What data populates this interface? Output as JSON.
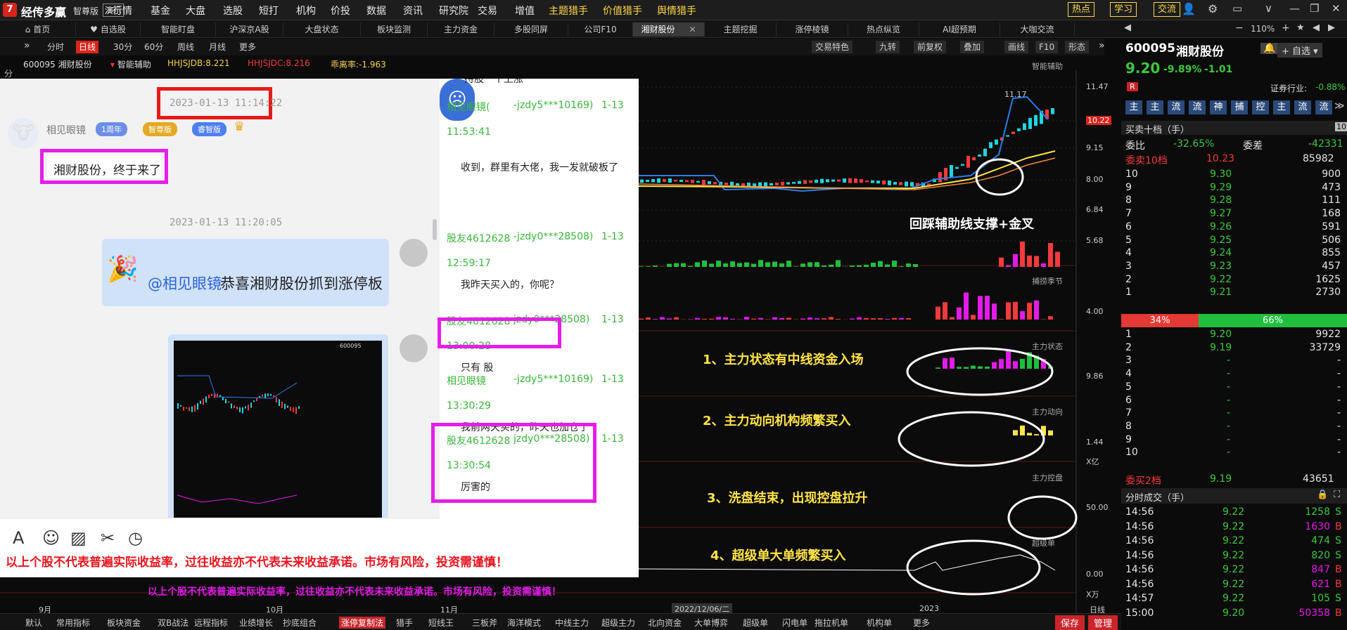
{
  "app": {
    "brand": "经传多赢",
    "edition": "智尊版",
    "demo": "演示"
  },
  "menu": [
    "行情",
    "基金",
    "大盘",
    "选股",
    "短打",
    "机构",
    "价投",
    "数据",
    "资讯",
    "研究院",
    "交易",
    "增值"
  ],
  "menu_yellow": [
    "主题猎手",
    "价值猎手",
    "舆情猎手"
  ],
  "right_buttons": [
    "热点",
    "学习",
    "交流"
  ],
  "tabs": [
    "首页",
    "自选股",
    "智能盯盘",
    "沪深京A股",
    "大盘状态",
    "板块监测",
    "主力资金",
    "多股同屏",
    "公司F10",
    "湘财股份",
    "主题挖掘",
    "涨停棱镜",
    "热点纵览",
    "AI超预期",
    "大咖交流"
  ],
  "zoom": "110%",
  "chart_toolbar": {
    "left": [
      "分时",
      "日线",
      "30分",
      "60分",
      "周线",
      "月线",
      "更多"
    ],
    "right": [
      "交易特色",
      "九转",
      "前复权",
      "叠加",
      "画线",
      "F10",
      "形态"
    ]
  },
  "info": {
    "code": "600095 湘财股份",
    "assist": "智能辅助",
    "hhs1": "HHJSJDB:8.221",
    "hhs2": "HHJSJDC:8.216",
    "bias": "乖离率:-1.963"
  },
  "side_label": "分",
  "panels": {
    "main": "智能辅助",
    "p2": "捕捞季节",
    "p3": "主力状态",
    "p4": "主力动向",
    "p5": "主力控盘",
    "p6": "超级单"
  },
  "axes": {
    "main": [
      "11.47",
      "10.22",
      "9.15",
      "8.00",
      "6.84",
      "5.68"
    ],
    "p2": "4.00",
    "p3": "9.86",
    "p4": "1.44",
    "p4u": "X亿",
    "p5": "50.00",
    "p6": "0.00",
    "p6u": "X万",
    "high": "11.17"
  },
  "annotations": {
    "a0": "回踩辅助线支撑+金叉",
    "a1": "1、主力状态有中线资金入场",
    "a2": "2、主力动向机构频繁买入",
    "a3": "3、洗盘结束，出现控盘拉升",
    "a4": "4、超级单大单频繁买入"
  },
  "dates": [
    "9月",
    "10月",
    "11月",
    "2022/12/06/二",
    "2023",
    "日线"
  ],
  "bottom_disclaimer": "以上个股不代表普遍实际收益率，过往收益亦不代表未来收益承诺。市场有风险，投资需谨慎！",
  "bottom_tabs": [
    "默认",
    "常用指标",
    "板块资金",
    "双B战法",
    "远程指标",
    "业绩增长",
    "抄底组合",
    "涨停复制法",
    "猎手",
    "短线王",
    "三板斧",
    "海洋模式",
    "中线主力",
    "超级主力",
    "北向资金",
    "大单博弈",
    "超级单",
    "闪电单",
    "拖拉机单",
    "机构单",
    "更多"
  ],
  "bottom_right": [
    "保存",
    "管理"
  ],
  "chat": {
    "ts1": "2023-01-13 11:14:22",
    "user": "相见眼镜",
    "badges": [
      "1周年",
      "智尊版",
      "睿智版"
    ],
    "msg1": "湘财股份，终于来了",
    "ts2": "2023-01-13 11:20:05",
    "congrats_at": "@相见眼镜",
    "congrats_text": "恭喜湘财股份抓到涨停板",
    "right": [
      {
        "name": "相见眼镜(",
        "id": "-jzdy5***10169)",
        "date": "1-13",
        "time": "11:53:41",
        "text": "收到，群里有大佬，我一发就破板了"
      },
      {
        "name": "股友4612628",
        "id": "-jzdy0***28508)",
        "date": "1-13",
        "time": "12:59:17",
        "text": "我昨天买入的，你呢？"
      },
      {
        "name": "股友4612628",
        "id": "jzdy0***28508)",
        "date": "1-13",
        "time": "13:00:28",
        "text": "只有    股"
      },
      {
        "name": "相见眼镜",
        "id": "-jzdy5***10169)",
        "date": "1-13",
        "time": "13:30:29",
        "text": "我前两天买的，昨天也加仓了"
      },
      {
        "name": "股友4612628",
        "id": "jzdy0***28508)",
        "date": "1-13",
        "time": "13:30:54",
        "text": "厉害的"
      }
    ],
    "top_cut": "持股一个上涨",
    "disclaimer": "以上个股不代表普遍实际收益率，过往收益亦不代表未来收益承诺。市场有风险，投资需谨慎！",
    "toolbar": [
      "A",
      "☺",
      "▨",
      "✂",
      "◷"
    ],
    "mini_code": "600095"
  },
  "quote": {
    "code": "600095",
    "name": "湘财股份",
    "add": "自选",
    "price": "9.20",
    "pct": "-9.89%",
    "chg": "-1.01",
    "industry_label": "证券行业:",
    "industry_pct": "-0.88%",
    "tags": [
      "主",
      "主",
      "流",
      "流",
      "神",
      "捕",
      "控",
      "主",
      "流",
      "流"
    ],
    "book_title": "买卖十档（手）",
    "book_num": "10",
    "weibi_label": "委比",
    "weibi": "-32.65%",
    "weicha_label": "委差",
    "weicha": "-42331",
    "ask_head": {
      "label": "委卖10档",
      "price": "10.23",
      "vol": "85982"
    },
    "asks": [
      [
        "10",
        "9.30",
        "900"
      ],
      [
        "9",
        "9.29",
        "473"
      ],
      [
        "8",
        "9.28",
        "111"
      ],
      [
        "7",
        "9.27",
        "168"
      ],
      [
        "6",
        "9.26",
        "591"
      ],
      [
        "5",
        "9.25",
        "506"
      ],
      [
        "4",
        "9.24",
        "855"
      ],
      [
        "3",
        "9.23",
        "457"
      ],
      [
        "2",
        "9.22",
        "1625"
      ],
      [
        "1",
        "9.21",
        "2730"
      ]
    ],
    "split_red": "34%",
    "split_green": "66%",
    "bids": [
      [
        "1",
        "9.20",
        "9922"
      ],
      [
        "2",
        "9.19",
        "33729"
      ],
      [
        "3",
        "-",
        "-"
      ],
      [
        "4",
        "-",
        "-"
      ],
      [
        "5",
        "-",
        "-"
      ],
      [
        "6",
        "-",
        "-"
      ],
      [
        "7",
        "-",
        "-"
      ],
      [
        "8",
        "-",
        "-"
      ],
      [
        "9",
        "-",
        "-"
      ],
      [
        "10",
        "-",
        "-"
      ]
    ],
    "bid_foot": {
      "label": "委买2档",
      "price": "9.19",
      "vol": "43651"
    },
    "trades_title": "分时成交（手）",
    "trades": [
      [
        "14:56",
        "9.22",
        "1258",
        "S"
      ],
      [
        "14:56",
        "9.22",
        "1630",
        "B"
      ],
      [
        "14:56",
        "9.22",
        "474",
        "S"
      ],
      [
        "14:56",
        "9.22",
        "820",
        "S"
      ],
      [
        "14:56",
        "9.22",
        "847",
        "B"
      ],
      [
        "14:56",
        "9.22",
        "621",
        "B"
      ],
      [
        "14:57",
        "9.22",
        "105",
        "S"
      ],
      [
        "15:00",
        "9.20",
        "50358",
        "B"
      ]
    ]
  },
  "colors": {
    "up": "#f23b3b",
    "down": "#3ec73e",
    "magenta": "#e21be8",
    "yellow": "#ffe44a",
    "blue": "#2b7de9"
  }
}
